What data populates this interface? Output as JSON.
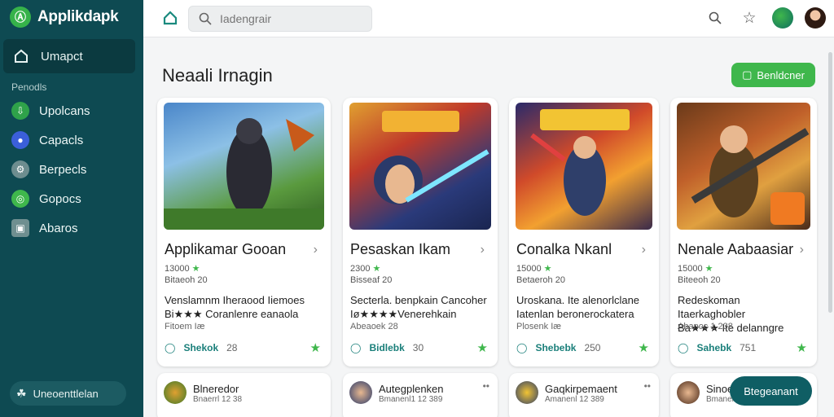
{
  "app": {
    "name": "Applikdapk"
  },
  "sidebar": {
    "active": {
      "label": "Umapct"
    },
    "section_label": "Penodls",
    "items": [
      {
        "label": "Upolcans",
        "icon": "download-icon",
        "color": "#2fa24a"
      },
      {
        "label": "Capacls",
        "icon": "planet-icon",
        "color": "#3b5fd9"
      },
      {
        "label": "Berpecls",
        "icon": "gear-icon",
        "color": "#6d8d8f"
      },
      {
        "label": "Gopocs",
        "icon": "chat-icon",
        "color": "#3fb74c"
      },
      {
        "label": "Abaros",
        "icon": "box-icon",
        "color": "#6f8f90"
      }
    ],
    "footer": {
      "label": "Uneoenttlelan",
      "icon": "leaf-icon"
    }
  },
  "topbar": {
    "search_placeholder": "Iadengrair"
  },
  "main": {
    "title": "Neaali Irnagin",
    "primary_button": "Benldcner",
    "fab_label": "Btegeanant"
  },
  "cards": [
    {
      "title": "Applikamar Gooan",
      "meta1": "13000",
      "meta2": "Bitaeoh 20",
      "desc1": "Venslamnm Iheraood Iiemoes",
      "desc2": "Bi★★★ Coranlenre eanaola",
      "sub": "Fitoem Iæ",
      "action": "Shekok",
      "count": "28"
    },
    {
      "title": "Pesaskan Ikam",
      "meta1": "2300",
      "meta2": "Bisseaf 20",
      "desc1": "Secterla. benpkain Cancoher",
      "desc2": "Iø★★★★Venerehkain",
      "sub": "Abeaoek 28",
      "action": "Bidlebk",
      "count": "30"
    },
    {
      "title": "Conalka Nkanl",
      "meta1": "15000",
      "meta2": "Betaeroh 20",
      "desc1": "Uroskana. Ite alenorlclane",
      "desc2": "Iatenlan beronerockatera",
      "sub": "Plosenk Iæ",
      "action": "Shebebk",
      "count": "250"
    },
    {
      "title": "Nenale Aabaasiar",
      "meta1": "15000",
      "meta2": "Biteeoh 20",
      "desc1": "Redeskoman Itaerkaghobler",
      "desc2": "Ba★★★ Ite delanngre",
      "sub": "Abanoc 1 238",
      "action": "Sahebk",
      "count": "751"
    }
  ],
  "mini_cards": [
    {
      "title": "Blneredor",
      "sub": "Bnaerrl 12 38"
    },
    {
      "title": "Autegplenken",
      "sub": "Bmanenl1 12 389"
    },
    {
      "title": "Gaqkirpemaent",
      "sub": "Amanenl 12 389"
    },
    {
      "title": "Sinoe",
      "sub": "Bmanenl1 22 389"
    }
  ],
  "colors": {
    "sidebar": "#0e4a52",
    "accent": "#3fb74c",
    "fab": "#0f5e64"
  }
}
